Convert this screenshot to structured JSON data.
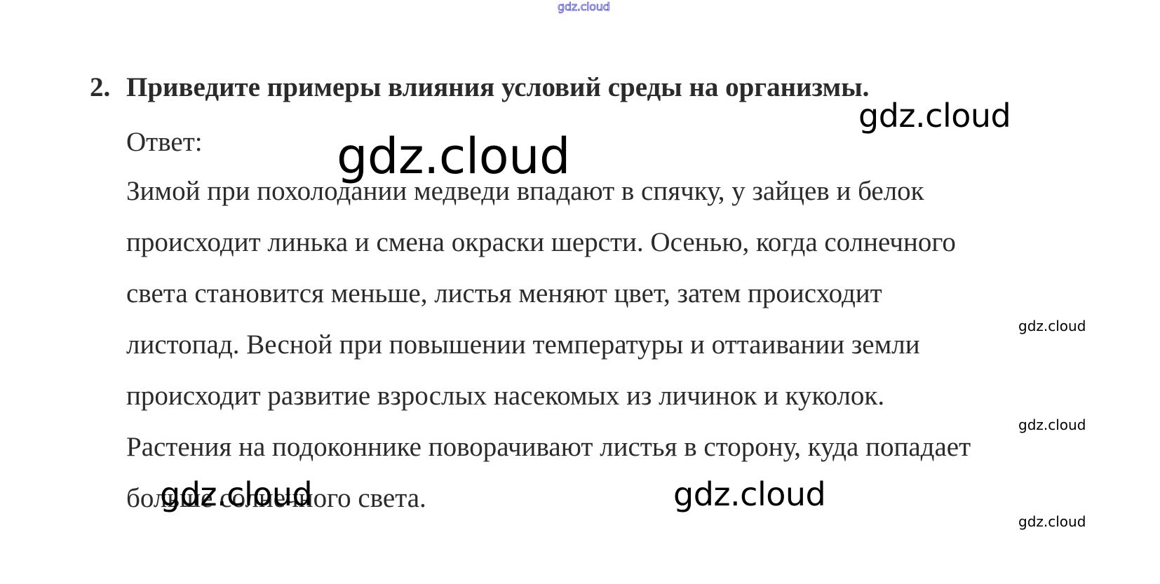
{
  "watermark_text": "gdz.cloud",
  "question": {
    "number": "2.",
    "text": "Приведите примеры влияния условий среды на организмы."
  },
  "answer": {
    "label": "Ответ:",
    "lines": [
      "Зимой при похолодании медведи впадают в спячку, у зайцев и белок",
      "происходит линька и смена окраски шерсти. Осенью, когда солнечного",
      "света становится меньше, листья меняют цвет, затем происходит",
      "листопад. Весной при повышении температуры и оттаивании земли",
      "происходит развитие взрослых насекомых из личинок и куколок.",
      "Растения на подоконнике поворачивают листья в сторону, куда попадает",
      "больше солнечного света."
    ]
  }
}
